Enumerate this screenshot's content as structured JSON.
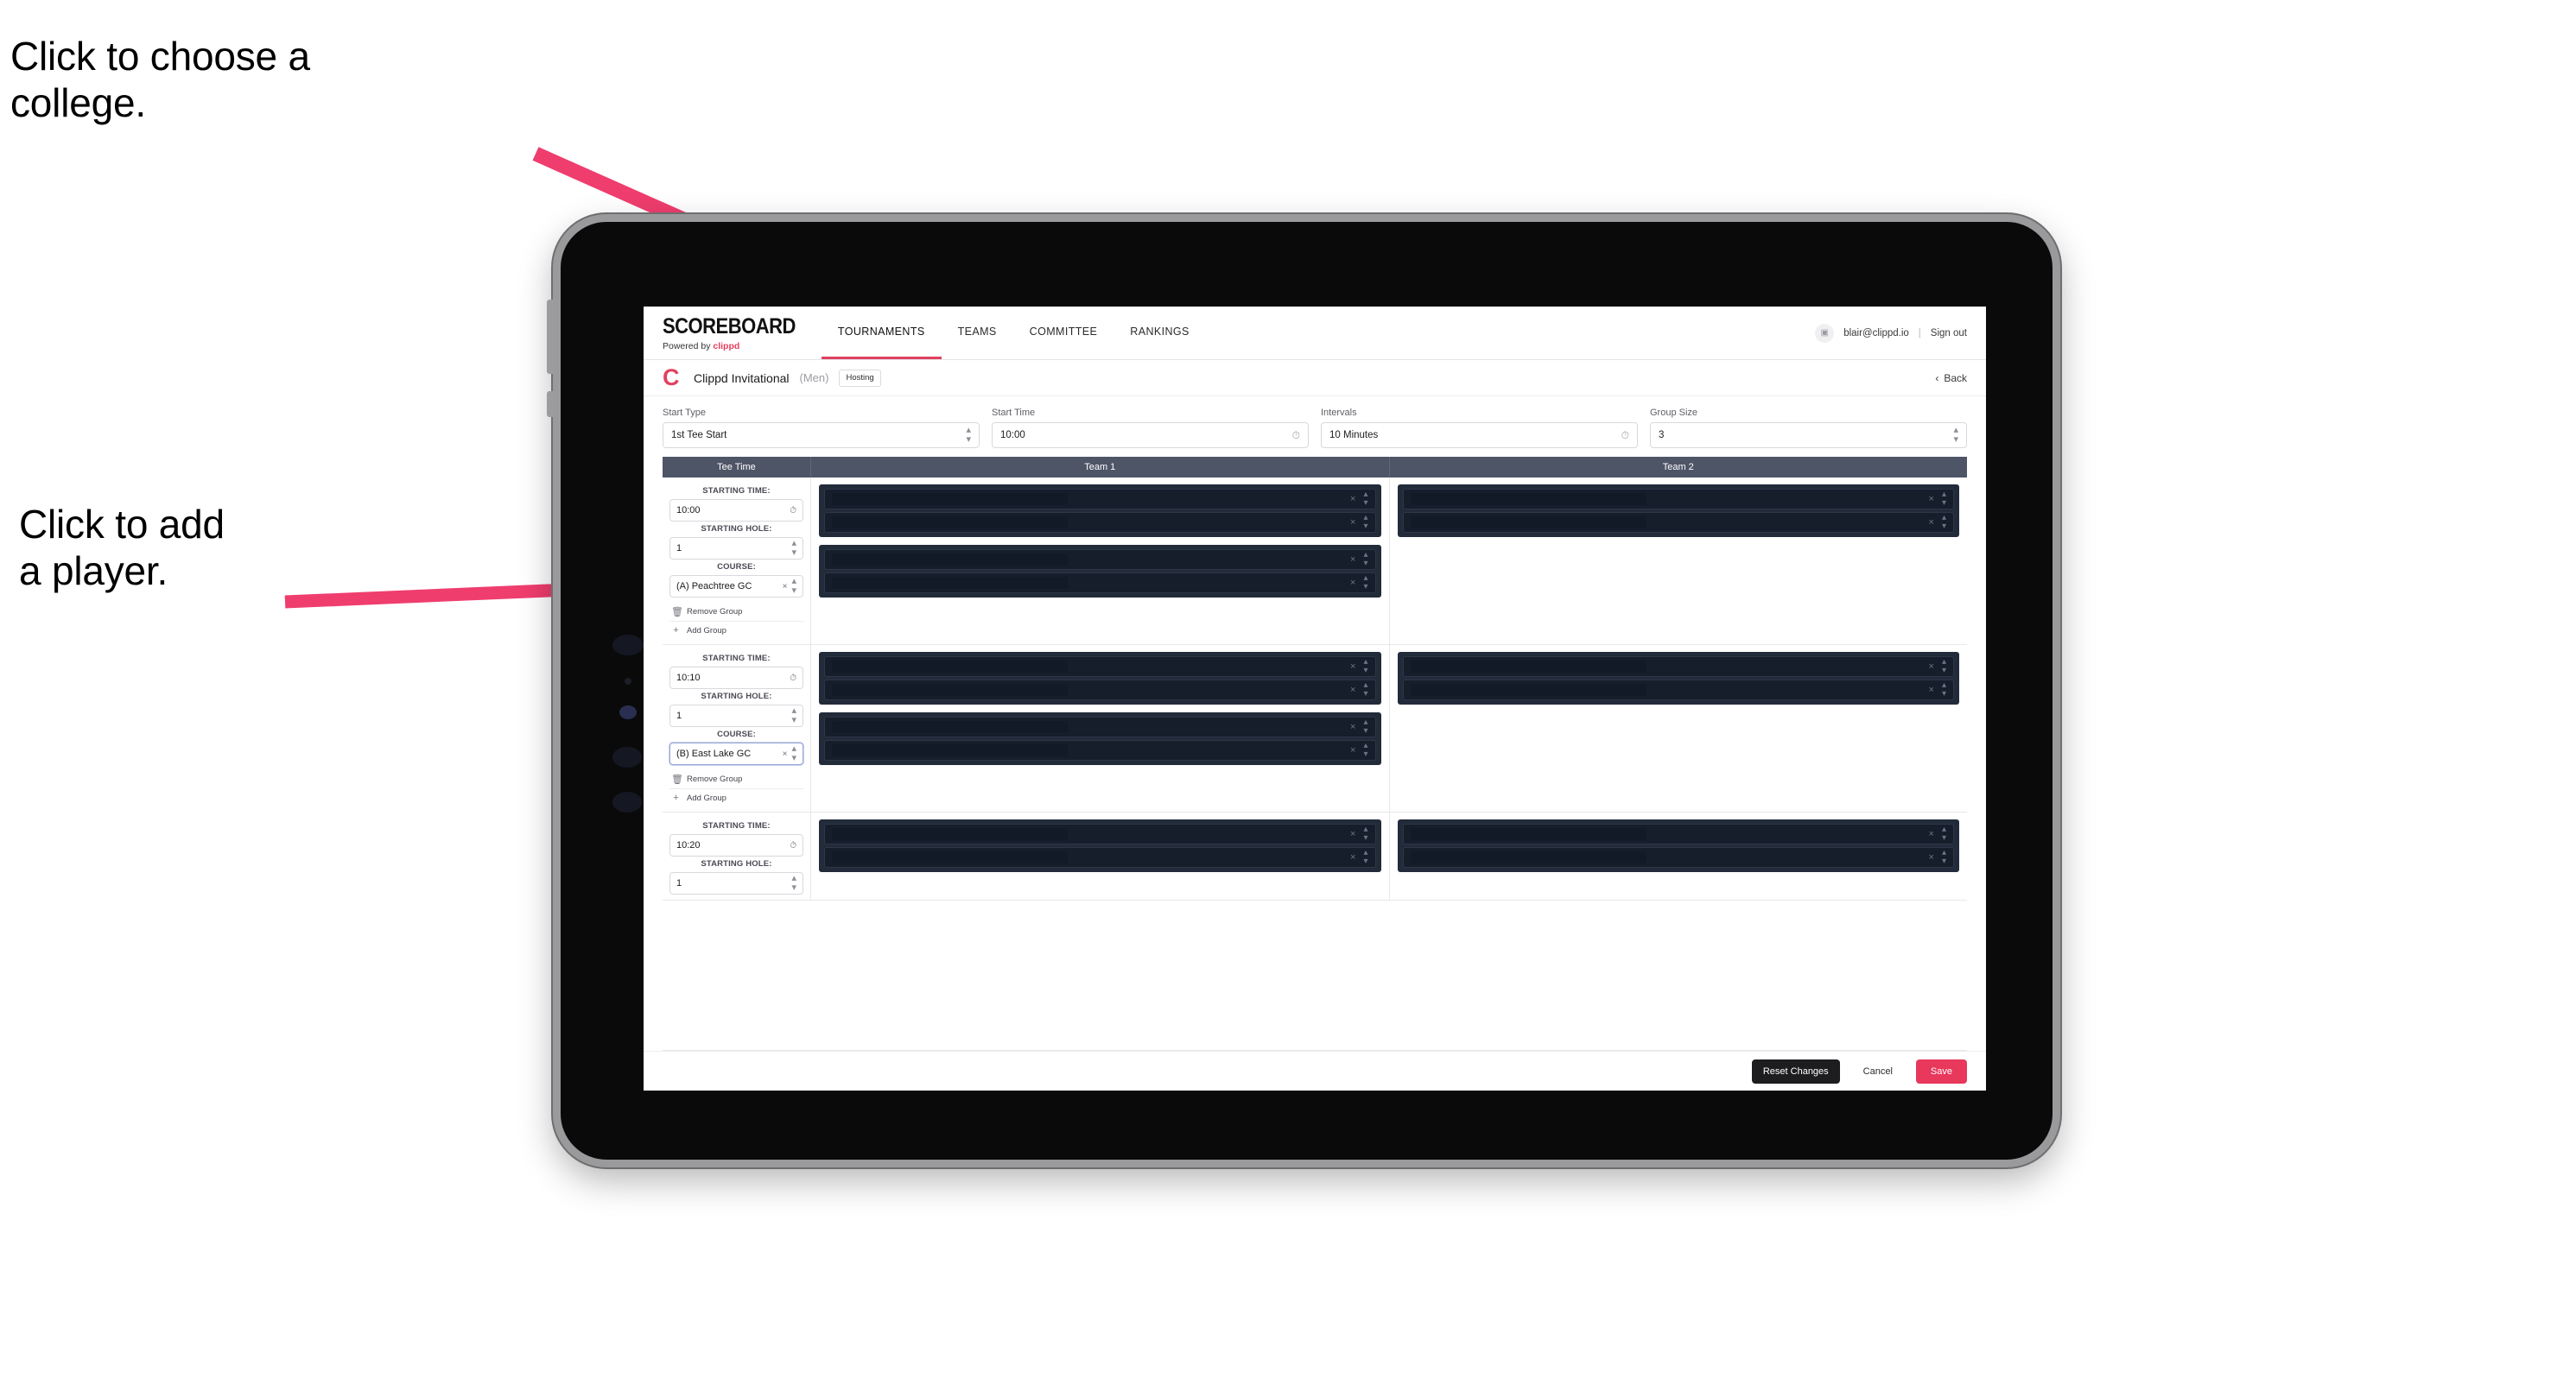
{
  "annotations": {
    "college": "Click to choose a\ncollege.",
    "player": "Click to add\na player."
  },
  "colors": {
    "accent": "#e8385c",
    "brand_pink": "#e1415f",
    "table_header": "#4e5567",
    "player_group_bg": "#222b3a",
    "player_row_bg": "#161d2b"
  },
  "app": {
    "brand": {
      "title": "SCOREBOARD",
      "powered_prefix": "Powered by ",
      "powered_brand": "clippd"
    },
    "nav": [
      {
        "label": "TOURNAMENTS",
        "active": true
      },
      {
        "label": "TEAMS",
        "active": false
      },
      {
        "label": "COMMITTEE",
        "active": false
      },
      {
        "label": "RANKINGS",
        "active": false
      }
    ],
    "account": {
      "avatar_icon": "user-avatar-icon",
      "email": "blair@clippd.io",
      "separator": "|",
      "sign_out": "Sign out"
    },
    "tournament": {
      "logo_letter": "C",
      "name": "Clippd Invitational",
      "gender": "(Men)",
      "badge": "Hosting",
      "back_label": "Back",
      "back_icon": "chevron-left-icon"
    },
    "controls": [
      {
        "label": "Start Type",
        "value": "1st Tee Start",
        "icon": "stepper-icon"
      },
      {
        "label": "Start Time",
        "value": "10:00",
        "icon": "clock-icon"
      },
      {
        "label": "Intervals",
        "value": "10 Minutes",
        "icon": "clock-icon"
      },
      {
        "label": "Group Size",
        "value": "3",
        "icon": "stepper-icon"
      }
    ],
    "table": {
      "headers": {
        "tee_time": "Tee Time",
        "team_1": "Team 1",
        "team_2": "Team 2"
      },
      "field_labels": {
        "starting_time": "STARTING TIME:",
        "starting_hole": "STARTING HOLE:",
        "course": "COURSE:"
      },
      "actions": {
        "remove_group": "Remove Group",
        "add_group": "Add Group",
        "remove_icon": "trash-icon",
        "add_icon": "plus-icon"
      },
      "row_icons": {
        "clear": "close-icon",
        "stepper": "stepper-icon",
        "clear_glyph": "×"
      },
      "rows": [
        {
          "starting_time": "10:00",
          "starting_hole": "1",
          "course": "(A) Peachtree GC",
          "course_focused": false,
          "team1_groups": [
            {
              "players": 2
            },
            {
              "players": 2
            }
          ],
          "team2_groups": [
            {
              "players": 2
            }
          ]
        },
        {
          "starting_time": "10:10",
          "starting_hole": "1",
          "course": "(B) East Lake GC",
          "course_focused": true,
          "team1_groups": [
            {
              "players": 2
            },
            {
              "players": 2
            }
          ],
          "team2_groups": [
            {
              "players": 2
            }
          ]
        },
        {
          "starting_time": "10:20",
          "starting_hole": "1",
          "course": "",
          "course_focused": false,
          "team1_groups": [
            {
              "players": 2
            }
          ],
          "team2_groups": [
            {
              "players": 2
            }
          ]
        }
      ]
    },
    "footer": {
      "reset": "Reset Changes",
      "cancel": "Cancel",
      "save": "Save"
    }
  }
}
